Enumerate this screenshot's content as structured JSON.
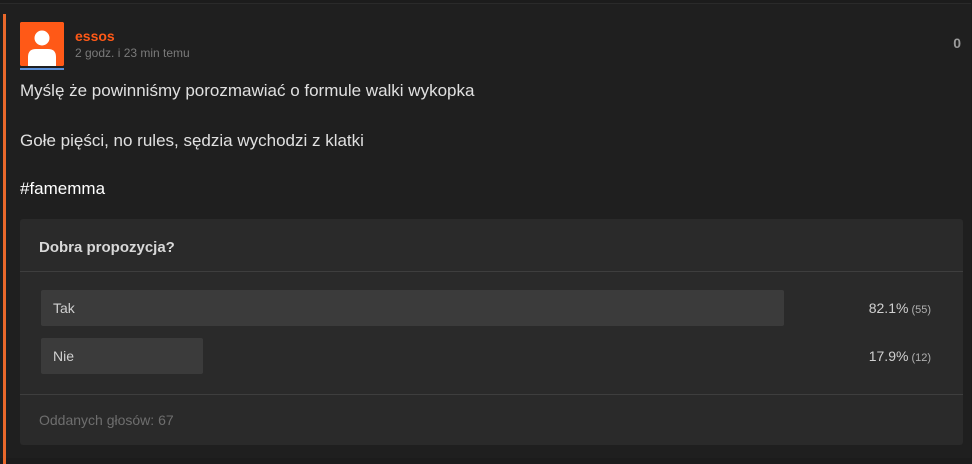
{
  "post": {
    "author": "essos",
    "time_ago": "2 godz. i 23 min temu",
    "vote_count": "0",
    "lines": [
      "Myślę że powinniśmy porozmawiać o formule walki wykopka",
      "Gołe pięści, no rules, sędzia wychodzi z klatki"
    ],
    "hashtag": "#famemma",
    "colors": {
      "accent": "#e9682b",
      "username": "#ff5917",
      "avatar_bg": "#ff5917"
    }
  },
  "poll": {
    "question": "Dobra propozycja?",
    "options": [
      {
        "label": "Tak",
        "percent": "82.1%",
        "votes": "(55)",
        "share": 0.821
      },
      {
        "label": "Nie",
        "percent": "17.9%",
        "votes": "(12)",
        "share": 0.179
      }
    ],
    "total": "Oddanych głosów: 67"
  }
}
